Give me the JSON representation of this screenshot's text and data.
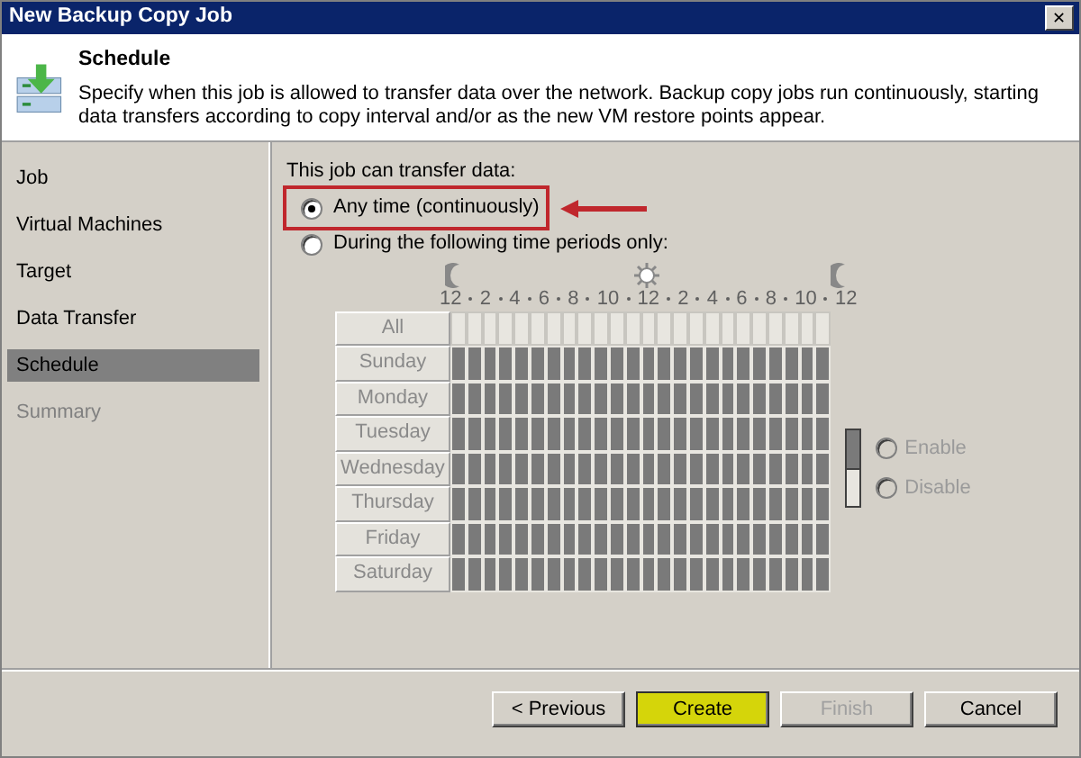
{
  "window": {
    "title": "New Backup Copy Job",
    "close": "✕"
  },
  "header": {
    "title": "Schedule",
    "description": "Specify when this job is allowed to transfer data over the network. Backup copy jobs run continuously, starting data transfers according to copy interval and/or as the new VM restore points appear."
  },
  "sidebar": {
    "items": [
      {
        "label": "Job",
        "selected": false,
        "disabled": false
      },
      {
        "label": "Virtual Machines",
        "selected": false,
        "disabled": false
      },
      {
        "label": "Target",
        "selected": false,
        "disabled": false
      },
      {
        "label": "Data Transfer",
        "selected": false,
        "disabled": false
      },
      {
        "label": "Schedule",
        "selected": true,
        "disabled": false
      },
      {
        "label": "Summary",
        "selected": false,
        "disabled": true
      }
    ]
  },
  "schedule": {
    "prompt": "This job can transfer data:",
    "options": [
      {
        "label": "Any time (continuously)",
        "selected": true,
        "annotated": true
      },
      {
        "label": "During the following time periods only:",
        "selected": false,
        "annotated": false
      }
    ],
    "grid": {
      "disabled": true,
      "hour_labels": [
        "12",
        "2",
        "4",
        "6",
        "8",
        "10",
        "12",
        "2",
        "4",
        "6",
        "8",
        "10",
        "12"
      ],
      "all_label": "All",
      "days": [
        {
          "label": "Sunday",
          "allowed": true
        },
        {
          "label": "Monday",
          "allowed": true
        },
        {
          "label": "Tuesday",
          "allowed": true
        },
        {
          "label": "Wednesday",
          "allowed": true
        },
        {
          "label": "Thursday",
          "allowed": true
        },
        {
          "label": "Friday",
          "allowed": true
        },
        {
          "label": "Saturday",
          "allowed": true
        }
      ]
    },
    "legend": [
      {
        "label": "Enable",
        "selected": false,
        "disabled": true
      },
      {
        "label": "Disable",
        "selected": false,
        "disabled": true
      }
    ]
  },
  "buttons": [
    {
      "label": "< Previous",
      "disabled": false,
      "highlighted": false
    },
    {
      "label": "Create",
      "disabled": false,
      "highlighted": true
    },
    {
      "label": "Finish",
      "disabled": true,
      "highlighted": false
    },
    {
      "label": "Cancel",
      "disabled": false,
      "highlighted": false
    }
  ]
}
